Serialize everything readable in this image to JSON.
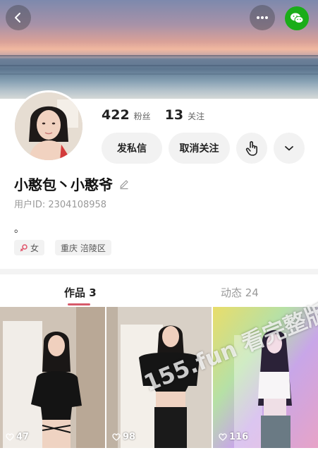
{
  "header": {
    "back_icon": "chevron-left-icon",
    "more_icon": "more-horizontal-icon",
    "share_icon": "wechat-icon",
    "wechat_color": "#1aad19"
  },
  "profile": {
    "followers_count": "422",
    "followers_label": "粉丝",
    "following_count": "13",
    "following_label": "关注",
    "message_button": "发私信",
    "unfollow_button": "取消关注",
    "poke_icon": "hand-pointer-icon",
    "expand_icon": "chevron-down-icon",
    "nickname": "小憨包丶小憨爷",
    "edit_icon": "pencil-icon",
    "user_id": "用户ID: 2304108958",
    "bio": "。",
    "gender_tag": "女",
    "gender_color": "#e0546a",
    "location_tag": "重庆 涪陵区"
  },
  "tabs": {
    "works_label": "作品 3",
    "activity_label": "动态 24",
    "active_color": "#d65a6a"
  },
  "videos": [
    {
      "likes": "47"
    },
    {
      "likes": "98"
    },
    {
      "likes": "116"
    }
  ],
  "watermark": "155.fun 看完整版"
}
